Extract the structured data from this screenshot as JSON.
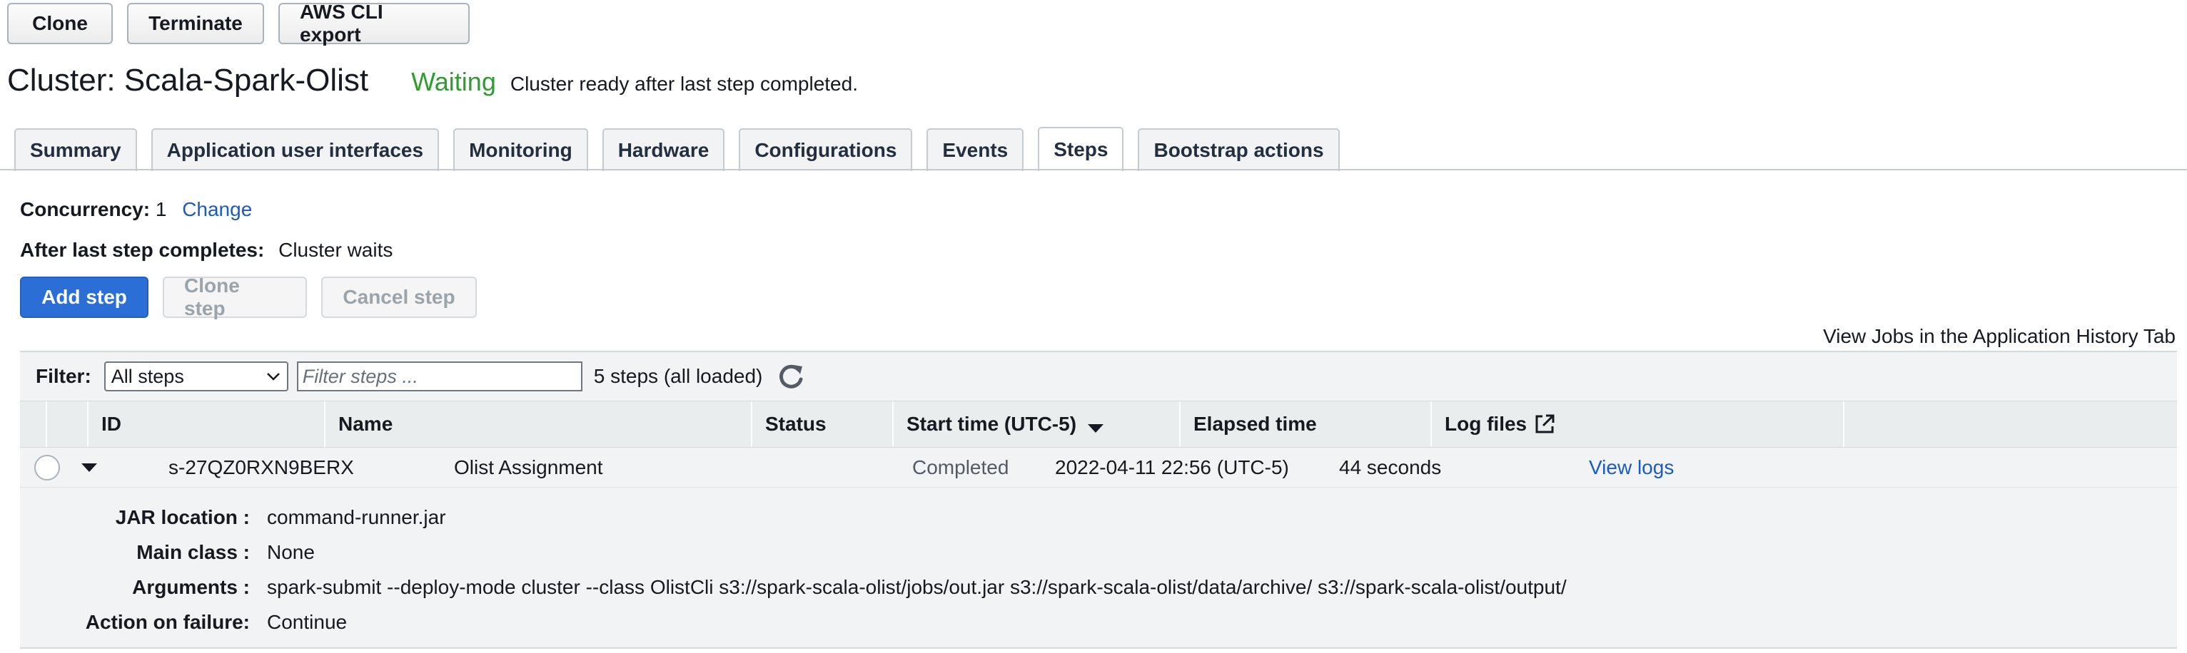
{
  "toolbar": {
    "clone_label": "Clone",
    "terminate_label": "Terminate",
    "cli_export_label": "AWS CLI export"
  },
  "cluster": {
    "title": "Cluster: Scala-Spark-Olist",
    "status": "Waiting",
    "status_message": "Cluster ready after last step completed.",
    "status_color": "#2e9c2e"
  },
  "tabs": [
    {
      "label": "Summary",
      "active": false
    },
    {
      "label": "Application user interfaces",
      "active": false
    },
    {
      "label": "Monitoring",
      "active": false
    },
    {
      "label": "Hardware",
      "active": false
    },
    {
      "label": "Configurations",
      "active": false
    },
    {
      "label": "Events",
      "active": false
    },
    {
      "label": "Steps",
      "active": true
    },
    {
      "label": "Bootstrap actions",
      "active": false
    }
  ],
  "steps_panel": {
    "concurrency_label": "Concurrency:",
    "concurrency_value": "1",
    "change_link": "Change",
    "after_last_label": "After last step completes:",
    "after_last_value": "Cluster waits",
    "add_step_label": "Add step",
    "clone_step_label": "Clone step",
    "cancel_step_label": "Cancel step",
    "history_link": "View Jobs in the Application History Tab"
  },
  "filter": {
    "label": "Filter:",
    "selected": "All steps",
    "placeholder": "Filter steps ...",
    "count_text": "5 steps (all loaded)"
  },
  "table": {
    "columns": [
      "ID",
      "Name",
      "Status",
      "Start time (UTC-5)",
      "Elapsed time",
      "Log files"
    ],
    "rows": [
      {
        "id": "s-27QZ0RXN9BERX",
        "name": "Olist Assignment",
        "status": "Completed",
        "start_time": "2022-04-11 22:56 (UTC-5)",
        "elapsed": "44 seconds",
        "log_link": "View logs"
      }
    ]
  },
  "step_details": {
    "jar_label": "JAR location :",
    "jar_value": "command-runner.jar",
    "main_class_label": "Main class :",
    "main_class_value": "None",
    "arguments_label": "Arguments :",
    "arguments_value": "spark-submit --deploy-mode cluster --class OlistCli s3://spark-scala-olist/jobs/out.jar s3://spark-scala-olist/data/archive/ s3://spark-scala-olist/output/",
    "failure_label": "Action on failure:",
    "failure_value": "Continue"
  },
  "colors": {
    "primary_button": "#2b6fd6",
    "link": "#1a5bc4"
  }
}
